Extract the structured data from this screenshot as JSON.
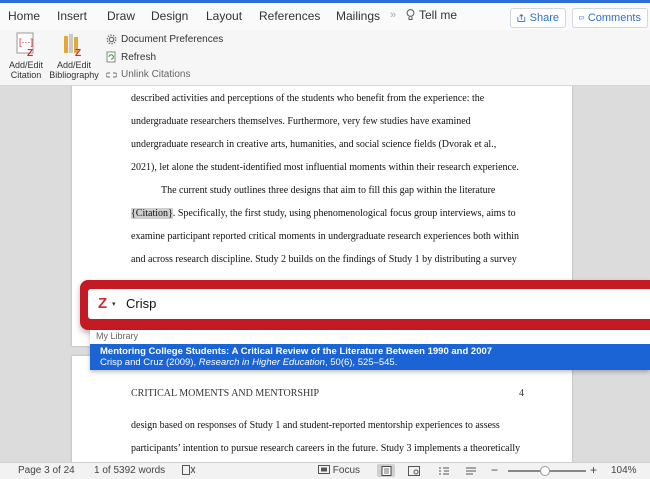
{
  "ribbon_tabs": [
    "Home",
    "Insert",
    "Draw",
    "Design",
    "Layout",
    "References",
    "Mailings"
  ],
  "overflow": "»",
  "tell_me": "Tell me",
  "share": "Share",
  "comments": "Comments",
  "ribbon": {
    "add_edit_citation": [
      "Add/Edit",
      "Citation"
    ],
    "add_edit_bibliography": [
      "Add/Edit",
      "Bibliography"
    ],
    "document_preferences": "Document Preferences",
    "refresh": "Refresh",
    "unlink_citations": "Unlink Citations"
  },
  "document": {
    "page1_lines": [
      "described activities and perceptions of the students who benefit from the experience: the",
      "undergraduate researchers themselves. Furthermore, very few studies have examined",
      "undergraduate research in creative arts, humanities, and social science fields (Dvorak et al.,",
      "2021), let alone the student-identified most influential moments within their research experience.",
      "The current study outlines three designs that aim to fill this gap within the literature",
      "{Citation}",
      ". Specifically, the first study, using phenomenological focus group interviews, aims to",
      "examine participant reported critical moments in undergraduate research experiences both within",
      "and across research discipline. Study 2 builds on the findings of Study 1 by distributing a survey"
    ],
    "running_head": "CRITICAL MOMENTS AND MENTORSHIP",
    "page_number": "4",
    "page2_lines": [
      "design based on responses of Study 1 and student-reported mentorship experiences to assess",
      "participants’ intention to pursue research careers in the future. Study 3 implements a theoretically"
    ]
  },
  "zotero": {
    "query": "Crisp",
    "library_label": "My Library",
    "result": {
      "title": "Mentoring College Students: A Critical Review of the Literature Between 1990 and 2007",
      "cite_prefix": "Crisp and Cruz (2009),",
      "journal": "Research in Higher Education",
      "cite_suffix": ", 50(6), 525–545."
    },
    "logo_letter": "Z",
    "chevron": "▾"
  },
  "status": {
    "page": "Page 3 of 24",
    "words": "1 of 5392 words",
    "focus": "Focus",
    "zoom_minus": "−",
    "zoom_plus": "+",
    "zoom": "104%"
  },
  "colors": {
    "accent": "#2b6fd6",
    "zotero_red": "#c41a24",
    "selection": "#1a64d6"
  }
}
